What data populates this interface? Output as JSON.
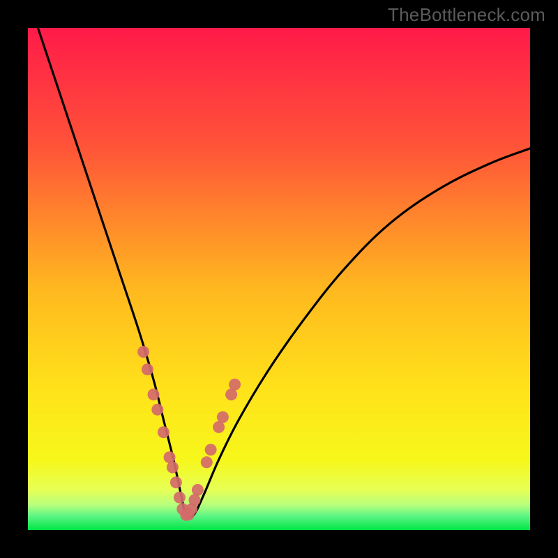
{
  "watermark": "TheBottleneck.com",
  "chart_data": {
    "type": "line",
    "title": "",
    "xlabel": "",
    "ylabel": "",
    "x_range": [
      0,
      100
    ],
    "y_range": [
      0,
      100
    ],
    "background_gradient": {
      "top_color": "#ff1a49",
      "mid_color": "#ffd21a",
      "green_band_color": "#00e546",
      "green_band_y": 3
    },
    "series": [
      {
        "name": "bottleneck-curve",
        "x": [
          2,
          6,
          10,
          14,
          18,
          22,
          25,
          27,
          29,
          30.5,
          31.5,
          33,
          35,
          38,
          42,
          48,
          55,
          63,
          72,
          82,
          92,
          100
        ],
        "y": [
          100,
          88,
          76,
          64,
          52,
          40,
          30,
          22,
          14,
          7,
          3,
          3,
          7,
          14,
          22,
          32,
          42,
          52,
          61,
          68,
          73,
          76
        ]
      }
    ],
    "markers": {
      "name": "sample-points",
      "color": "#d46a6a",
      "x": [
        23.0,
        23.8,
        25.0,
        25.8,
        27.0,
        28.2,
        28.8,
        29.5,
        30.2,
        30.8,
        31.5,
        32.0,
        32.6,
        33.2,
        33.8,
        35.6,
        36.4,
        38.0,
        38.8,
        40.5,
        41.2
      ],
      "y": [
        35.5,
        32.0,
        27.0,
        24.0,
        19.5,
        14.5,
        12.5,
        9.5,
        6.5,
        4.2,
        3.0,
        3.1,
        4.2,
        6.0,
        8.0,
        13.5,
        16.0,
        20.5,
        22.5,
        27.0,
        29.0
      ]
    }
  }
}
